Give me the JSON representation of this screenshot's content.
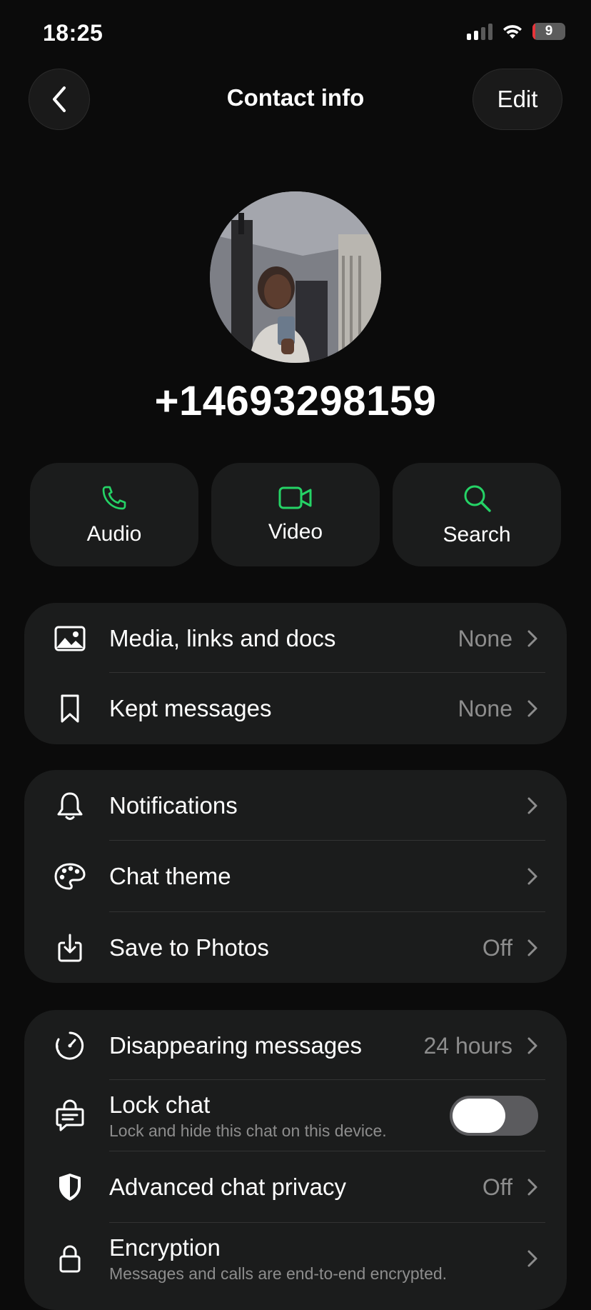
{
  "status": {
    "time": "18:25",
    "battery": "9",
    "battery_level": 0.09,
    "signal_bars": 2
  },
  "header": {
    "title": "Contact info",
    "edit_label": "Edit",
    "back_icon": "chevron-left-icon"
  },
  "profile": {
    "phone": "+14693298159"
  },
  "actions": [
    {
      "label": "Audio",
      "icon": "phone-icon"
    },
    {
      "label": "Video",
      "icon": "video-icon"
    },
    {
      "label": "Search",
      "icon": "search-icon"
    }
  ],
  "colors": {
    "accent": "#25d366",
    "card": "#1b1c1c",
    "background": "#0b0b0b",
    "secondary_text": "#8d8d8d"
  },
  "group1": [
    {
      "label": "Media, links and docs",
      "value": "None",
      "icon": "image-icon"
    },
    {
      "label": "Kept messages",
      "value": "None",
      "icon": "bookmark-icon"
    }
  ],
  "group2": [
    {
      "label": "Notifications",
      "value": "",
      "icon": "bell-icon"
    },
    {
      "label": "Chat theme",
      "value": "",
      "icon": "palette-icon"
    },
    {
      "label": "Save to Photos",
      "value": "Off",
      "icon": "download-icon"
    }
  ],
  "group3": [
    {
      "label": "Disappearing messages",
      "value": "24 hours",
      "icon": "timer-icon"
    },
    {
      "label": "Lock chat",
      "sub": "Lock and hide this chat on this device.",
      "icon": "lock-chat-icon",
      "toggle_on": false
    },
    {
      "label": "Advanced chat privacy",
      "value": "Off",
      "icon": "shield-icon"
    },
    {
      "label": "Encryption",
      "sub": "Messages and calls are end-to-end encrypted.",
      "icon": "lock-icon"
    }
  ]
}
